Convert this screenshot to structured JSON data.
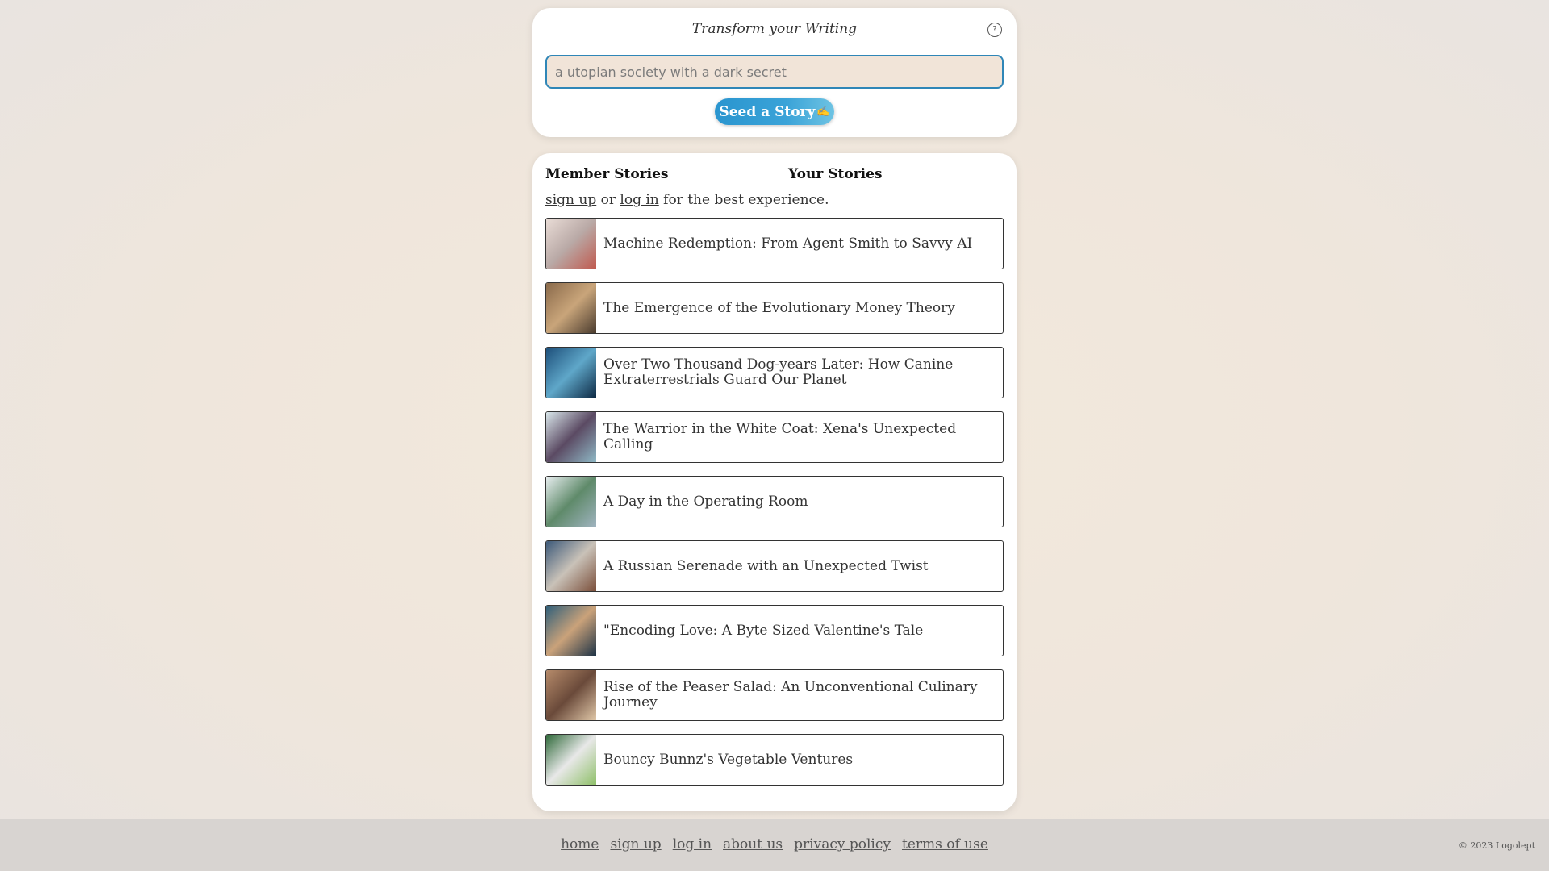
{
  "seed": {
    "title": "Transform your Writing",
    "help_icon": "question-circle-icon",
    "input_placeholder": "a utopian society with a dark secret",
    "button_label": "Seed a Story",
    "button_icon": "pencil-icon"
  },
  "stories": {
    "tabs": [
      {
        "label": "Member Stories"
      },
      {
        "label": "Your Stories"
      }
    ],
    "signup": {
      "signup_link": "sign up",
      "or_text": " or ",
      "login_link": "log in",
      "suffix": " for the best experience."
    },
    "items": [
      {
        "title": "Machine Redemption: From Agent Smith to Savvy AI",
        "thumb_colors": [
          "#e9dcd6",
          "#b9a9a6",
          "#c05a4f"
        ]
      },
      {
        "title": "The Emergence of the Evolutionary Money Theory",
        "thumb_colors": [
          "#8a6a4b",
          "#c9a57a",
          "#4a3b2e"
        ]
      },
      {
        "title": "Over Two Thousand Dog-years Later: How Canine Extraterrestrials Guard Our Planet",
        "thumb_colors": [
          "#1d4f7a",
          "#5fa7c9",
          "#0d2a44"
        ]
      },
      {
        "title": "The Warrior in the White Coat: Xena's Unexpected Calling",
        "thumb_colors": [
          "#d8e6ea",
          "#5b4a63",
          "#8fb9c6"
        ]
      },
      {
        "title": "A Day in the Operating Room",
        "thumb_colors": [
          "#e8eef0",
          "#5f8a6a",
          "#9fb3bf"
        ]
      },
      {
        "title": "A Russian Serenade with an Unexpected Twist",
        "thumb_colors": [
          "#3d5a7a",
          "#c9c2b8",
          "#7a4e3a"
        ]
      },
      {
        "title": "\"Encoding Love: A Byte Sized Valentine's Tale",
        "thumb_colors": [
          "#2f5f7a",
          "#caa27a",
          "#1e3346"
        ]
      },
      {
        "title": "Rise of the Peaser Salad: An Unconventional Culinary Journey",
        "thumb_colors": [
          "#b58a6a",
          "#6a4a3a",
          "#e0c7a8"
        ]
      },
      {
        "title": "Bouncy Bunnz's Vegetable Ventures",
        "thumb_colors": [
          "#2f6a3a",
          "#e8e8e8",
          "#8fc06a"
        ]
      }
    ]
  },
  "footer": {
    "links": [
      "home",
      "sign up",
      "log in",
      "about us",
      "privacy policy",
      "terms of use"
    ],
    "copyright": "© 2023 Logolept"
  }
}
